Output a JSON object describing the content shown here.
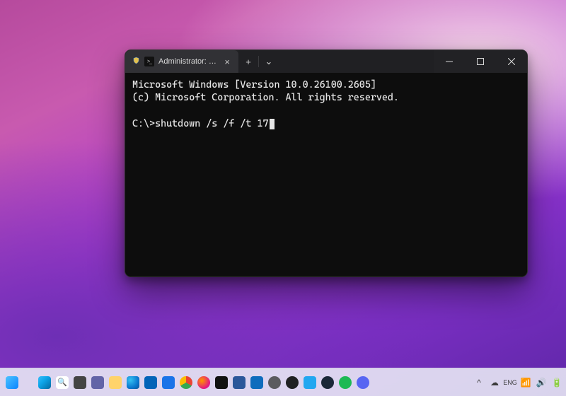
{
  "window": {
    "tab_title": "Administrator: Command Pro",
    "tab_icon": "terminal-icon",
    "new_tab_label": "+",
    "dropdown_label": "⌄",
    "caption": {
      "minimize": "Minimize",
      "maximize": "Maximize",
      "close": "Close"
    }
  },
  "terminal": {
    "line1": "Microsoft Windows [Version 10.0.26100.2605]",
    "line2": "(c) Microsoft Corporation. All rights reserved.",
    "blank": "",
    "prompt": "C:\\>",
    "command": "shutdown /s /f /t 17"
  },
  "taskbar": {
    "items": [
      {
        "name": "start",
        "label": "Start"
      },
      {
        "name": "search",
        "label": "Search"
      },
      {
        "name": "task-view",
        "label": "Task View"
      },
      {
        "name": "chat",
        "label": "Chat"
      },
      {
        "name": "file-explorer",
        "label": "File Explorer"
      },
      {
        "name": "edge",
        "label": "Microsoft Edge"
      },
      {
        "name": "outlook",
        "label": "Outlook"
      },
      {
        "name": "store",
        "label": "Microsoft Store"
      },
      {
        "name": "chrome",
        "label": "Google Chrome"
      },
      {
        "name": "firefox",
        "label": "Firefox"
      },
      {
        "name": "terminal",
        "label": "Terminal"
      },
      {
        "name": "word",
        "label": "Word"
      },
      {
        "name": "mail",
        "label": "Mail"
      },
      {
        "name": "settings",
        "label": "Settings"
      },
      {
        "name": "chatgpt",
        "label": "ChatGPT"
      },
      {
        "name": "vscode",
        "label": "VS Code"
      },
      {
        "name": "steam",
        "label": "Steam"
      },
      {
        "name": "spotify",
        "label": "Spotify"
      },
      {
        "name": "discord",
        "label": "Discord"
      }
    ],
    "tray": {
      "chevron": "^",
      "onedrive": "OneDrive",
      "language": "ENG",
      "network": "Wi-Fi",
      "volume": "Volume",
      "battery": "Battery"
    }
  },
  "colors": {
    "window_bg": "#0d0d0d",
    "titlebar_bg": "#222225",
    "tab_active_bg": "#313135",
    "text": "#e6e6e6"
  }
}
